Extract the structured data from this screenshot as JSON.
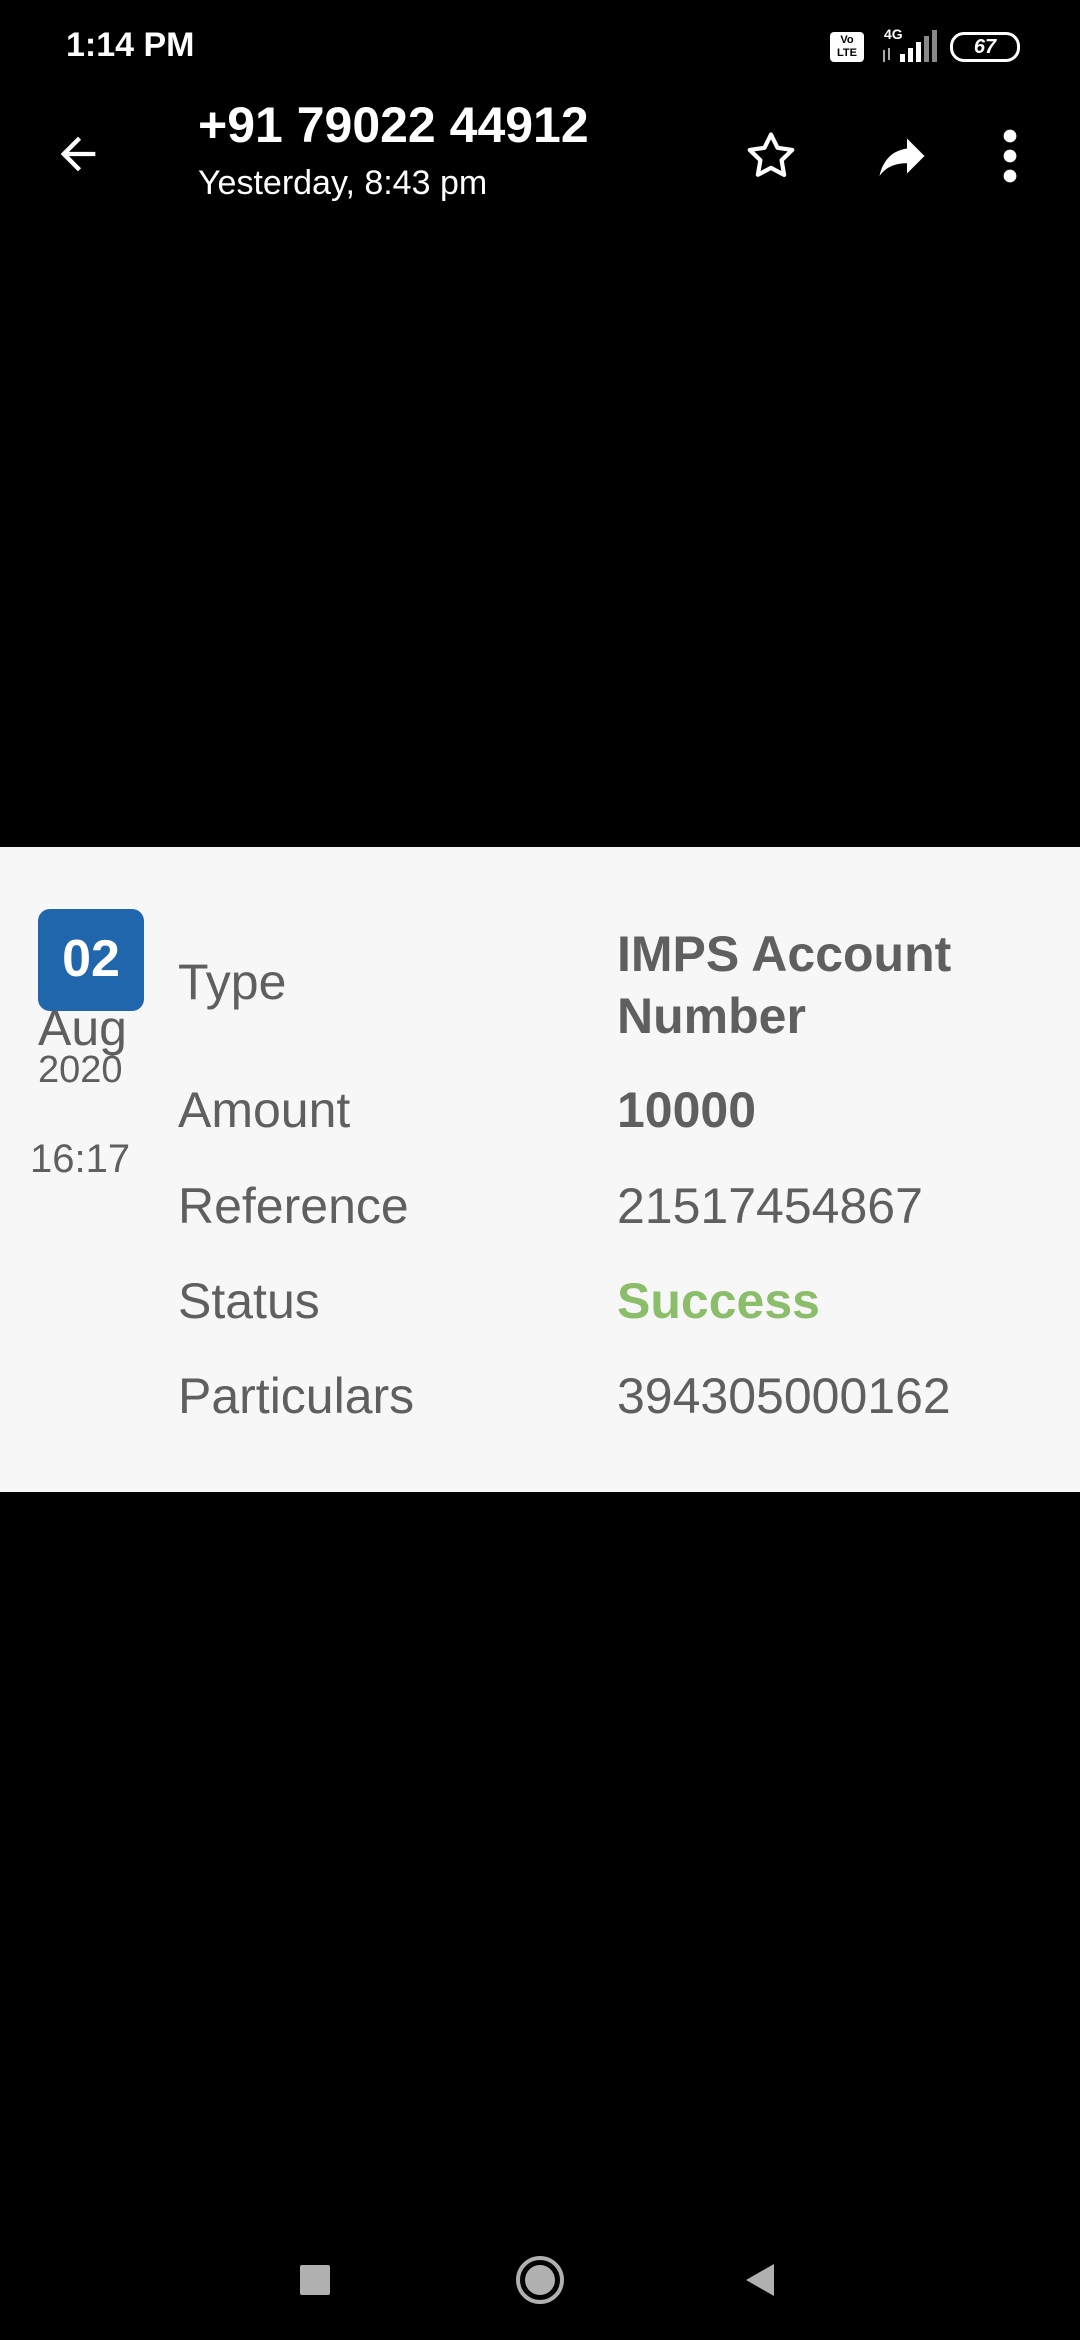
{
  "status_bar": {
    "time": "1:14 PM",
    "volte_label": "Vo LTE",
    "network_label": "4G",
    "battery_level": "67"
  },
  "app_bar": {
    "contact_number": "+91 79022 44912",
    "subtitle": "Yesterday, 8:43 pm",
    "icons": [
      "back-arrow-icon",
      "star-icon",
      "forward-icon",
      "more-vert-icon"
    ]
  },
  "message_card": {
    "date": {
      "day": "02",
      "month": "Aug",
      "year": "2020",
      "time": "16:17",
      "badge_color": "#1f66ad"
    },
    "rows": [
      {
        "label": "Type",
        "value": "IMPS Account Number"
      },
      {
        "label": "Amount",
        "value": "10000"
      },
      {
        "label": "Reference",
        "value": "21517454867"
      },
      {
        "label": "Status",
        "value": "Success",
        "color": "#8bbd6a"
      },
      {
        "label": "Particulars",
        "value": "394305000162"
      }
    ]
  },
  "nav_bar": {
    "icons": [
      "recents-square-icon",
      "home-circle-icon",
      "back-triangle-icon"
    ]
  }
}
